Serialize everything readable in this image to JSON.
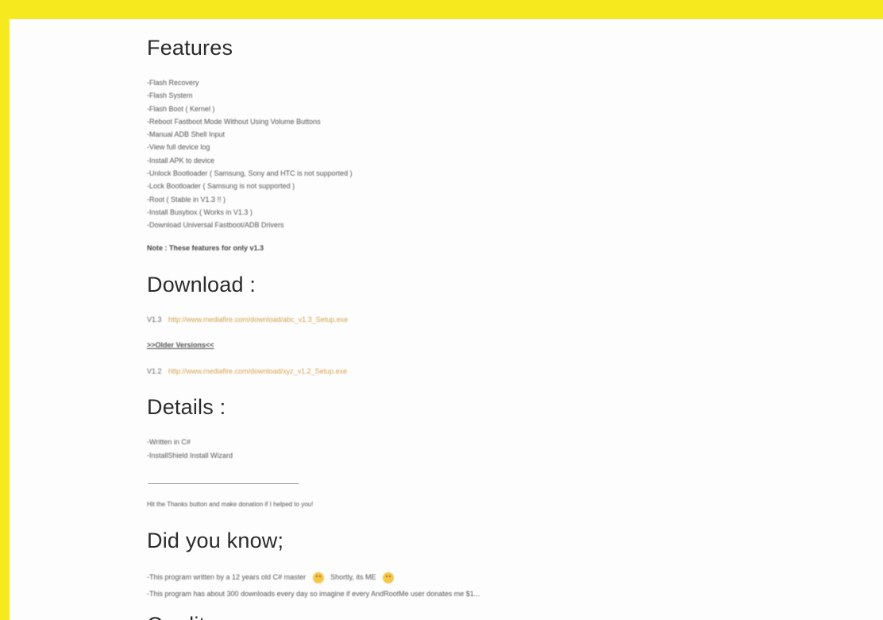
{
  "features": {
    "heading": "Features",
    "items": [
      "-Flash Recovery",
      "-Flash System",
      "-Flash Boot ( Kernel )",
      "-Reboot Fastboot Mode Without Using Volume Buttons",
      "-Manual ADB Shell Input",
      "-View full device log",
      "-Install APK to device",
      "-Unlock Bootloader ( Samsung, Sony and HTC is not supported )",
      "-Lock Bootloader ( Samsung is not supported )",
      "-Root ( Stable in V1.3 !! )",
      "-Install Busybox ( Works in V1.3 )",
      "-Download Universal Fastboot/ADB Drivers"
    ],
    "note": "Note : These features for only v1.3"
  },
  "download": {
    "heading": "Download :",
    "latest": {
      "version": "V1.3",
      "link_text": "http://www.mediafire.com/download/abc_v1.3_Setup.exe"
    },
    "older_label": ">>Older Versions<<",
    "older": {
      "version": "V1.2",
      "link_text": "http://www.mediafire.com/download/xyz_v1.2_Setup.exe"
    }
  },
  "details": {
    "heading": "Details :",
    "items": [
      "-Written in C#",
      "-InstallShield Install Wizard"
    ],
    "thanks": "Hit the Thanks button and make donation if I helped to you!"
  },
  "did_you_know": {
    "heading": "Did you know;",
    "line1_a": "-This program written by a 12 years old C# master",
    "line1_b": "Shortly, its ME",
    "line2": "-This program has about 300 downloads every day so imagine if every AndRootMe user donates me $1..."
  },
  "next_heading": "Credits :",
  "emoji_icon": "smiley-face-icon"
}
